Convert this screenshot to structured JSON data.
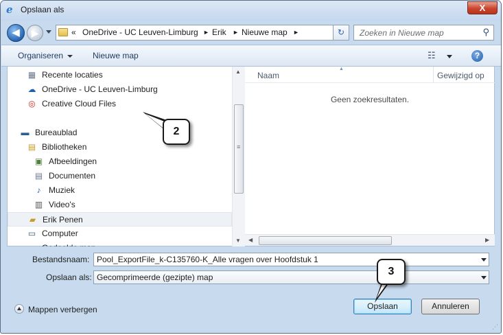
{
  "window": {
    "title": "Opslaan als",
    "close_label": "X"
  },
  "nav": {
    "back_glyph": "◀",
    "forward_glyph": "▶",
    "breadcrumb": [
      "«",
      "OneDrive - UC Leuven-Limburg",
      "►",
      "Erik",
      "►",
      "Nieuwe map",
      "►"
    ],
    "refresh_glyph": "↻",
    "search_placeholder": "Zoeken in Nieuwe map"
  },
  "toolbar": {
    "organize_label": "Organiseren",
    "new_folder_label": "Nieuwe map",
    "view_icon_glyph": "☷",
    "help_label": "?"
  },
  "sidebar": {
    "items": [
      {
        "label": "Recente locaties",
        "icon": "recent-places-icon",
        "glyph": "▦",
        "color": "#6b7a8c"
      },
      {
        "label": "OneDrive - UC Leuven-Limburg",
        "icon": "onedrive-icon",
        "glyph": "☁",
        "color": "#1f5fb0"
      },
      {
        "label": "Creative Cloud Files",
        "icon": "creative-cloud-icon",
        "glyph": "◎",
        "color": "#d4281c"
      },
      {
        "label": "Bureaublad",
        "icon": "desktop-icon",
        "glyph": "▬",
        "color": "#2c5d9b"
      },
      {
        "label": "Bibliotheken",
        "icon": "libraries-icon",
        "glyph": "▤",
        "color": "#c69b2a"
      },
      {
        "label": "Afbeeldingen",
        "icon": "pictures-icon",
        "glyph": "▣",
        "color": "#4f7f3a"
      },
      {
        "label": "Documenten",
        "icon": "documents-icon",
        "glyph": "▤",
        "color": "#6b7a8c"
      },
      {
        "label": "Muziek",
        "icon": "music-icon",
        "glyph": "♪",
        "color": "#2a63b3"
      },
      {
        "label": "Video's",
        "icon": "videos-icon",
        "glyph": "▥",
        "color": "#555555"
      },
      {
        "label": "Erik Penen",
        "icon": "user-folder-icon",
        "glyph": "▰",
        "color": "#c69b2a"
      },
      {
        "label": "Computer",
        "icon": "computer-icon",
        "glyph": "▭",
        "color": "#3c5978"
      },
      {
        "label": "Gedeelde map",
        "icon": "network-icon",
        "glyph": "▭",
        "color": "#3c5978"
      }
    ],
    "selected_index": 9
  },
  "filelist": {
    "col_name": "Naam",
    "col_modified": "Gewijzigd op",
    "empty_message": "Geen zoekresultaten."
  },
  "form": {
    "filename_label": "Bestandsnaam:",
    "filename_value": "Pool_ExportFile_k-C135760-K_Alle vragen over Hoofdstuk 1",
    "savetype_label": "Opslaan als:",
    "savetype_value": "Gecomprimeerde (gezipte) map"
  },
  "footer": {
    "hide_folders_label": "Mappen verbergen",
    "save_label": "Opslaan",
    "cancel_label": "Annuleren"
  },
  "callouts": {
    "two": "2",
    "three": "3"
  }
}
